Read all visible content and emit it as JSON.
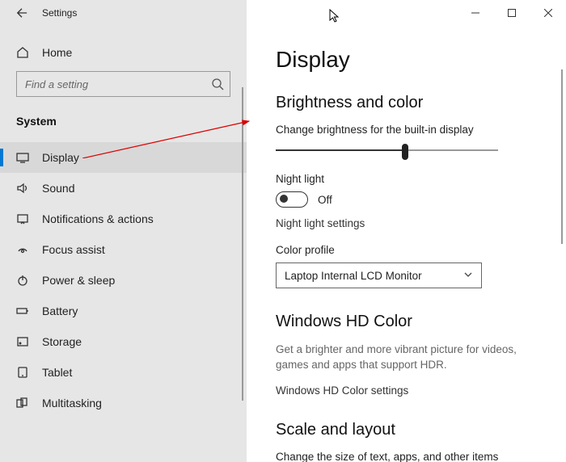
{
  "titlebar": {
    "title": "Settings"
  },
  "sidebar": {
    "home": "Home",
    "search_placeholder": "Find a setting",
    "category": "System",
    "items": [
      {
        "label": "Display"
      },
      {
        "label": "Sound"
      },
      {
        "label": "Notifications & actions"
      },
      {
        "label": "Focus assist"
      },
      {
        "label": "Power & sleep"
      },
      {
        "label": "Battery"
      },
      {
        "label": "Storage"
      },
      {
        "label": "Tablet"
      },
      {
        "label": "Multitasking"
      }
    ]
  },
  "content": {
    "page_title": "Display",
    "section1": "Brightness and color",
    "brightness_label": "Change brightness for the built-in display",
    "night_light_label": "Night light",
    "night_light_state": "Off",
    "night_light_settings": "Night light settings",
    "color_profile_label": "Color profile",
    "color_profile_value": "Laptop Internal LCD Monitor",
    "section2": "Windows HD Color",
    "hd_desc": "Get a brighter and more vibrant picture for videos, games and apps that support HDR.",
    "hd_link": "Windows HD Color settings",
    "section3": "Scale and layout",
    "scale_desc": "Change the size of text, apps, and other items"
  }
}
